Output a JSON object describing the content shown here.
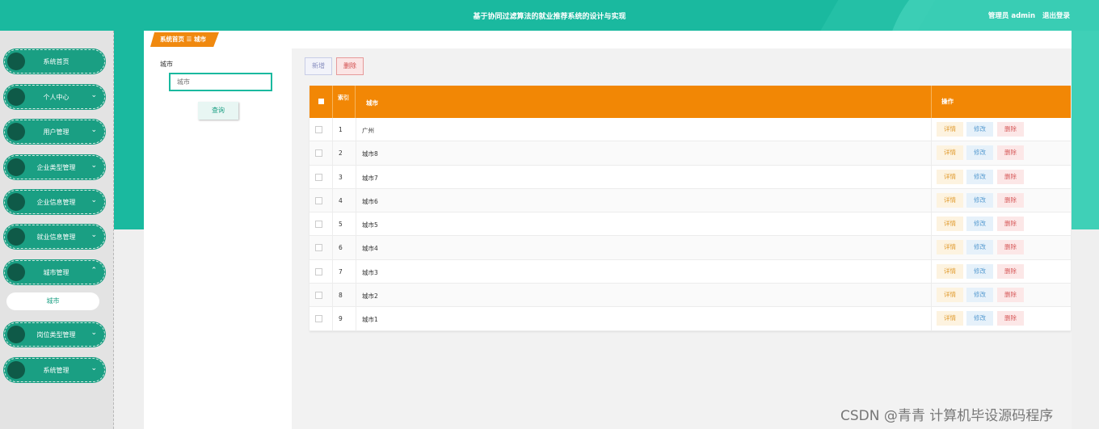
{
  "header": {
    "title": "基于协同过滤算法的就业推荐系统的设计与实现",
    "user_label": "管理员 admin",
    "logout": "退出登录"
  },
  "sidebar": {
    "items": [
      {
        "label": "系统首页",
        "chevron": ""
      },
      {
        "label": "个人中心",
        "chevron": "⌄"
      },
      {
        "label": "用户管理",
        "chevron": "⌄"
      },
      {
        "label": "企业类型管理",
        "chevron": "⌄"
      },
      {
        "label": "企业信息管理",
        "chevron": "⌄"
      },
      {
        "label": "就业信息管理",
        "chevron": "⌄"
      },
      {
        "label": "城市管理",
        "chevron": "⌃"
      },
      {
        "label": "岗位类型管理",
        "chevron": "⌄"
      },
      {
        "label": "系统管理",
        "chevron": "⌄"
      }
    ],
    "submenu": "城市"
  },
  "breadcrumb": {
    "home": "系统首页",
    "sep": "☰",
    "current": "城市"
  },
  "search": {
    "label": "城市",
    "placeholder": "城市",
    "button": "查询"
  },
  "toolbar": {
    "add": "新增",
    "delete": "删除"
  },
  "table": {
    "headers": {
      "index": "索引",
      "city": "城市",
      "actions": "操作"
    },
    "rows": [
      {
        "index": "1",
        "city": "广州"
      },
      {
        "index": "2",
        "city": "城市8"
      },
      {
        "index": "3",
        "city": "城市7"
      },
      {
        "index": "4",
        "city": "城市6"
      },
      {
        "index": "5",
        "city": "城市5"
      },
      {
        "index": "6",
        "city": "城市4"
      },
      {
        "index": "7",
        "city": "城市3"
      },
      {
        "index": "8",
        "city": "城市2"
      },
      {
        "index": "9",
        "city": "城市1"
      }
    ],
    "actions": {
      "detail": "详情",
      "edit": "修改",
      "delete": "删除"
    }
  },
  "watermark": "CSDN @青青  计算机毕设源码程序",
  "colors": {
    "teal": "#1ab99f",
    "orange": "#f28705",
    "menu": "#1a9f83"
  }
}
